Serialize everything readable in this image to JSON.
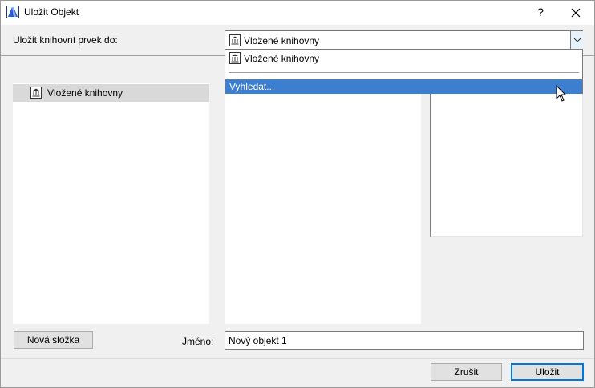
{
  "window": {
    "title": "Uložit Objekt",
    "help_label": "?",
    "close_label": "✕"
  },
  "save_to": {
    "label": "Uložit knihovní prvek do:",
    "selected": "Vložené knihovny"
  },
  "dropdown": {
    "items": [
      "Vložené knihovny",
      "Vyhledat..."
    ],
    "highlighted_index": 1
  },
  "tree": {
    "items": [
      {
        "label": "Vložené knihovny",
        "selected": true
      }
    ]
  },
  "footer": {
    "new_folder_label": "Nová složka",
    "name_label": "Jméno:",
    "name_value": "Nový objekt 1",
    "cancel_label": "Zrušit",
    "save_label": "Uložit"
  },
  "icons": {
    "app": "archicad-app-icon",
    "library": "library-building-icon",
    "chevron": "chevron-down-icon",
    "cursor": "mouse-pointer-icon"
  },
  "colors": {
    "highlight": "#3c7fd0",
    "selected_row": "#d9d9d9",
    "default_button_border": "#0078d7"
  }
}
